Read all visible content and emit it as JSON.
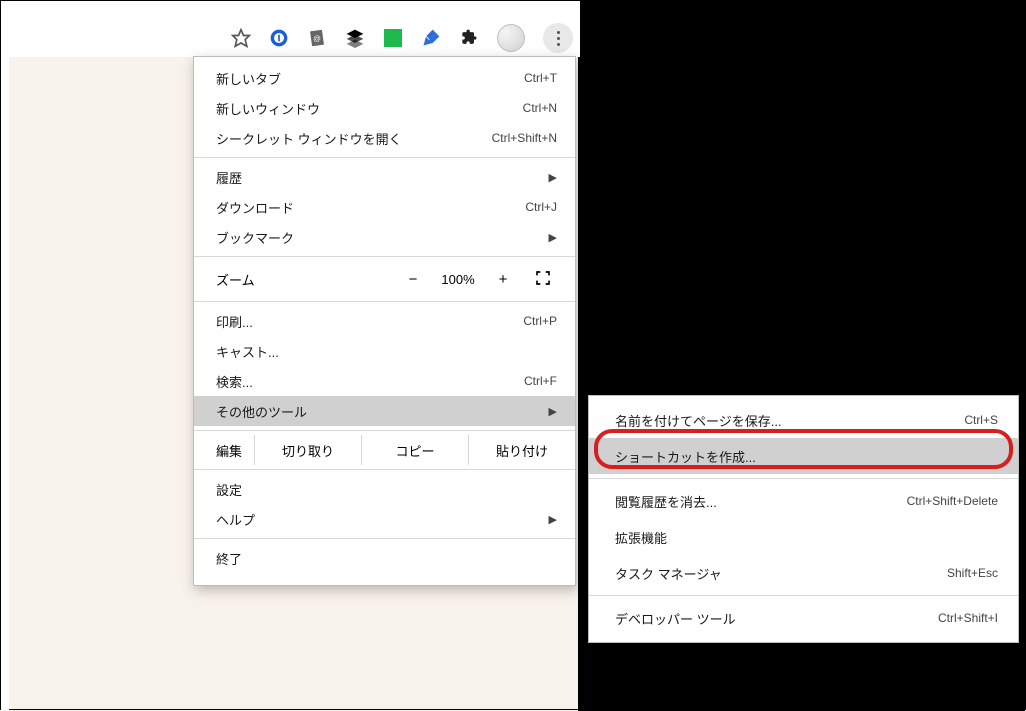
{
  "toolbar": {
    "icons": [
      "star-icon",
      "onepassword-icon",
      "doc-icon",
      "layers-icon",
      "square-icon",
      "quill-icon",
      "puzzle-icon"
    ]
  },
  "menu": {
    "new_tab": {
      "label": "新しいタブ",
      "shortcut": "Ctrl+T"
    },
    "new_window": {
      "label": "新しいウィンドウ",
      "shortcut": "Ctrl+N"
    },
    "incognito": {
      "label": "シークレット ウィンドウを開く",
      "shortcut": "Ctrl+Shift+N"
    },
    "history": {
      "label": "履歴"
    },
    "downloads": {
      "label": "ダウンロード",
      "shortcut": "Ctrl+J"
    },
    "bookmarks": {
      "label": "ブックマーク"
    },
    "zoom": {
      "label": "ズーム",
      "value": "100%",
      "minus": "−",
      "plus": "+"
    },
    "print": {
      "label": "印刷...",
      "shortcut": "Ctrl+P"
    },
    "cast": {
      "label": "キャスト..."
    },
    "find": {
      "label": "検索...",
      "shortcut": "Ctrl+F"
    },
    "more_tools": {
      "label": "その他のツール"
    },
    "edit": {
      "label": "編集",
      "cut": "切り取り",
      "copy": "コピー",
      "paste": "貼り付け"
    },
    "settings": {
      "label": "設定"
    },
    "help": {
      "label": "ヘルプ"
    },
    "exit": {
      "label": "終了"
    }
  },
  "submenu": {
    "save_as": {
      "label": "名前を付けてページを保存...",
      "shortcut": "Ctrl+S"
    },
    "create_shortcut": {
      "label": "ショートカットを作成..."
    },
    "clear_history": {
      "label": "閲覧履歴を消去...",
      "shortcut": "Ctrl+Shift+Delete"
    },
    "extensions": {
      "label": "拡張機能"
    },
    "task_manager": {
      "label": "タスク マネージャ",
      "shortcut": "Shift+Esc"
    },
    "dev_tools": {
      "label": "デベロッパー ツール",
      "shortcut": "Ctrl+Shift+I"
    }
  }
}
